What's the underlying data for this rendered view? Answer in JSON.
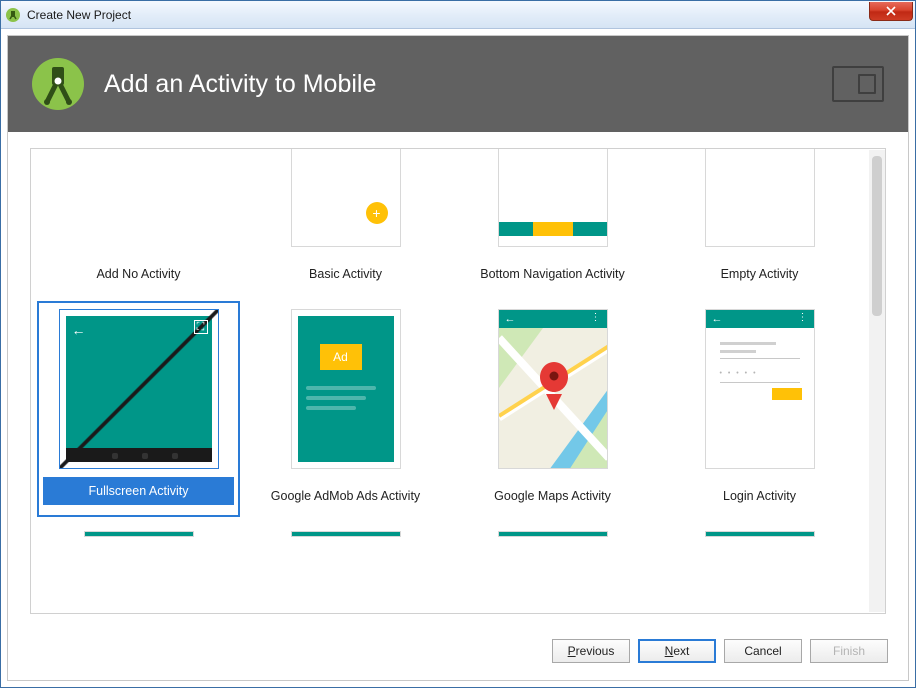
{
  "window": {
    "title": "Create New Project"
  },
  "header": {
    "title": "Add an Activity to Mobile"
  },
  "gallery": {
    "tiles": [
      {
        "label": "Add No Activity"
      },
      {
        "label": "Basic Activity"
      },
      {
        "label": "Bottom Navigation Activity"
      },
      {
        "label": "Empty Activity"
      },
      {
        "label": "Fullscreen Activity"
      },
      {
        "label": "Google AdMob Ads Activity",
        "ad_text": "Ad"
      },
      {
        "label": "Google Maps Activity"
      },
      {
        "label": "Login Activity"
      }
    ],
    "selected_index": 4
  },
  "footer": {
    "previous": "Previous",
    "next": "Next",
    "cancel": "Cancel",
    "finish": "Finish"
  }
}
